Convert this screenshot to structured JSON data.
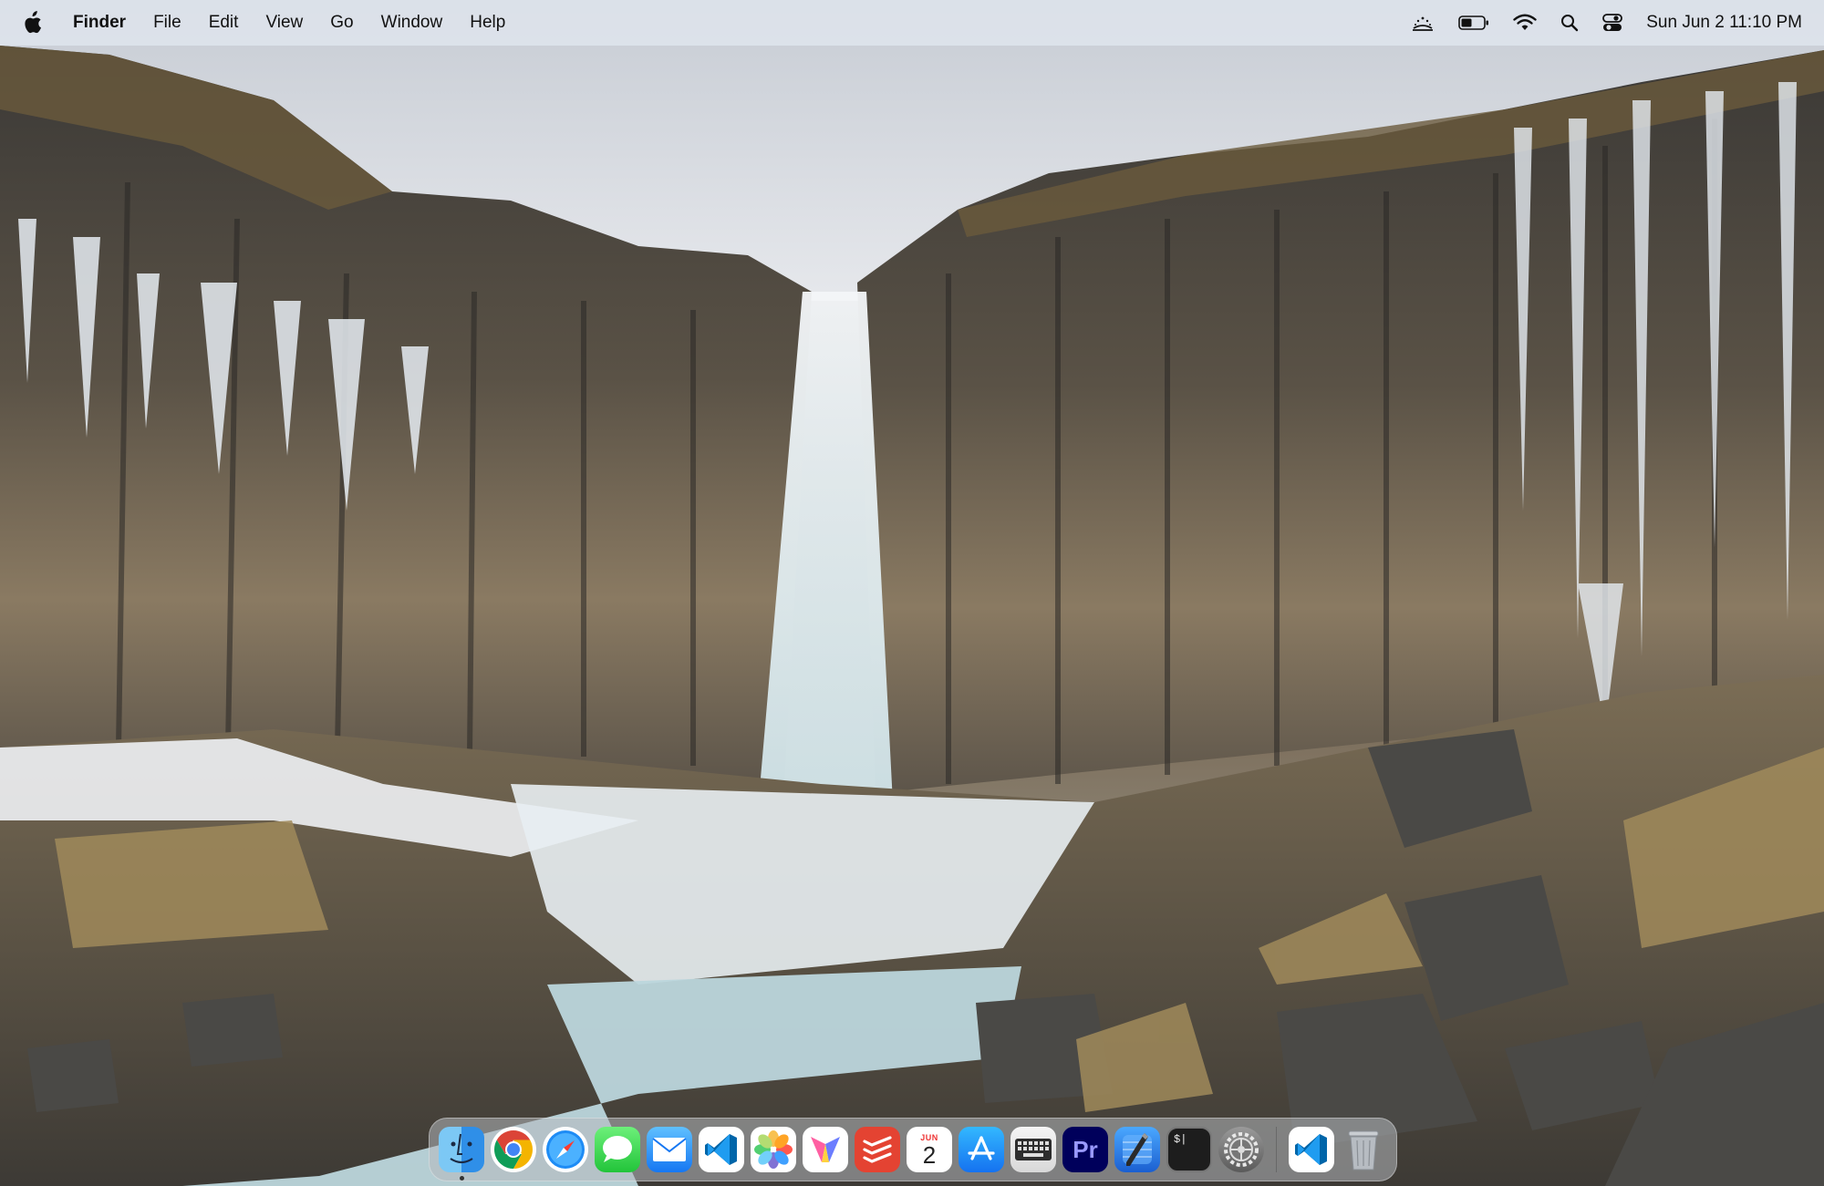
{
  "menubar": {
    "apple_icon": "apple-logo-icon",
    "app_name": "Finder",
    "menus": [
      "File",
      "Edit",
      "View",
      "Go",
      "Window",
      "Help"
    ],
    "status_icons": [
      "weather-icon",
      "battery-icon",
      "wifi-icon",
      "spotlight-search-icon",
      "control-center-icon"
    ],
    "clock": "Sun Jun 2  11:10 PM"
  },
  "dock": {
    "apps": [
      {
        "name": "Finder",
        "icon": "finder-icon",
        "running": true
      },
      {
        "name": "Google Chrome",
        "icon": "chrome-icon",
        "running": false
      },
      {
        "name": "Safari",
        "icon": "safari-icon",
        "running": false
      },
      {
        "name": "Messages",
        "icon": "messages-icon",
        "running": false
      },
      {
        "name": "Mail",
        "icon": "mail-icon",
        "running": false
      },
      {
        "name": "Visual Studio Code",
        "icon": "vscode-icon",
        "running": false
      },
      {
        "name": "Photos",
        "icon": "photos-icon",
        "running": false
      },
      {
        "name": "Vectorize",
        "icon": "vectorize-icon",
        "running": false
      },
      {
        "name": "Todoist",
        "icon": "todoist-icon",
        "running": false
      },
      {
        "name": "Calendar",
        "icon": "calendar-icon",
        "running": false
      },
      {
        "name": "App Store",
        "icon": "app-store-icon",
        "running": false
      },
      {
        "name": "Keyboard",
        "icon": "keyboard-icon",
        "running": false
      },
      {
        "name": "Premiere Pro",
        "icon": "premiere-icon",
        "running": false
      },
      {
        "name": "Xcode",
        "icon": "xcode-icon",
        "running": false
      },
      {
        "name": "Terminal",
        "icon": "terminal-icon",
        "running": false
      },
      {
        "name": "System Settings",
        "icon": "settings-icon",
        "running": false
      }
    ],
    "recent": [
      {
        "name": "Visual Studio Code",
        "icon": "vscode-icon"
      },
      {
        "name": "Trash",
        "icon": "trash-icon"
      }
    ],
    "calendar_month": "JUN",
    "calendar_day": "2",
    "premiere_label": "Pr",
    "terminal_prompt": "$|"
  }
}
